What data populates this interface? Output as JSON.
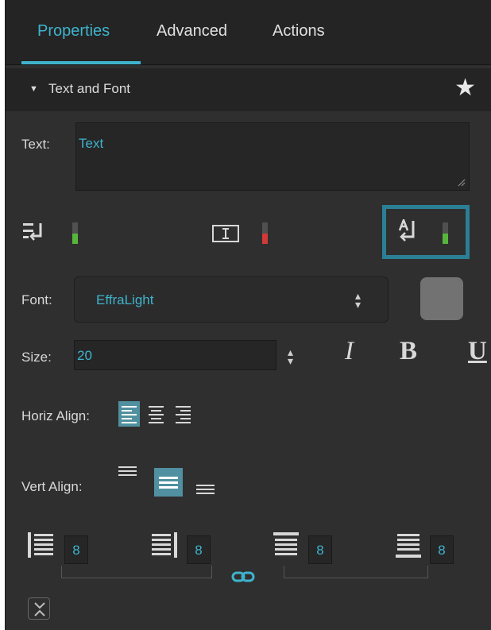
{
  "tabs": [
    {
      "label": "Properties",
      "active": true
    },
    {
      "label": "Advanced",
      "active": false
    },
    {
      "label": "Actions",
      "active": false
    }
  ],
  "section": {
    "arrow": "▼",
    "title": "Text and Font",
    "favorite_icon": "star-icon"
  },
  "text": {
    "label": "Text:",
    "value": "Text"
  },
  "toggles": [
    {
      "icon": "word-wrap-icon",
      "state": "on",
      "color": "#58b53c"
    },
    {
      "icon": "text-cursor-box-icon",
      "state": "off",
      "color": "#d23a3a"
    },
    {
      "icon": "auto-size-return-icon",
      "state": "on",
      "color": "#58b53c",
      "highlighted": true
    }
  ],
  "font": {
    "label": "Font:",
    "value": "EffraLight",
    "swatch_color": "#727272"
  },
  "size": {
    "label": "Size:",
    "value": "20",
    "italic": "I",
    "bold": "B",
    "underline": "U"
  },
  "horiz_align": {
    "label": "Horiz Align:",
    "options": [
      "left",
      "center",
      "right"
    ],
    "selected": "left"
  },
  "vert_align": {
    "label": "Vert Align:",
    "options": [
      "top",
      "middle",
      "bottom"
    ],
    "selected": "middle"
  },
  "padding": [
    {
      "side": "left",
      "value": "8"
    },
    {
      "side": "right",
      "value": "8"
    },
    {
      "side": "top",
      "value": "8"
    },
    {
      "side": "bottom",
      "value": "8"
    }
  ],
  "colors": {
    "accent": "#3fb3cd",
    "highlight_border": "#2b7f95",
    "selected_button": "#5090a0"
  }
}
